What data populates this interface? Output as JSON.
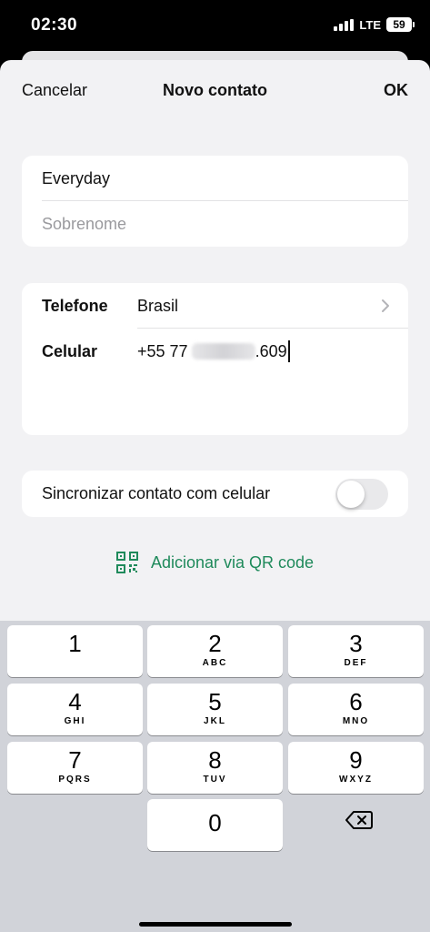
{
  "status_bar": {
    "time": "02:30",
    "network": "LTE",
    "battery": "59"
  },
  "nav": {
    "cancel": "Cancelar",
    "title": "Novo contato",
    "ok": "OK"
  },
  "name_card": {
    "first_name_value": "Everyday",
    "last_name_placeholder": "Sobrenome"
  },
  "phone_card": {
    "phone_label": "Telefone",
    "country": "Brasil",
    "mobile_label": "Celular",
    "mobile_prefix": "+55  77",
    "mobile_suffix": ".609"
  },
  "sync": {
    "label": "Sincronizar contato com celular",
    "enabled": false
  },
  "qr": {
    "label": "Adicionar via QR code",
    "color": "#1f8a5b"
  },
  "keypad": {
    "keys": [
      {
        "num": "1",
        "letters": ""
      },
      {
        "num": "2",
        "letters": "ABC"
      },
      {
        "num": "3",
        "letters": "DEF"
      },
      {
        "num": "4",
        "letters": "GHI"
      },
      {
        "num": "5",
        "letters": "JKL"
      },
      {
        "num": "6",
        "letters": "MNO"
      },
      {
        "num": "7",
        "letters": "PQRS"
      },
      {
        "num": "8",
        "letters": "TUV"
      },
      {
        "num": "9",
        "letters": "WXYZ"
      },
      {
        "num": "0",
        "letters": ""
      }
    ],
    "backspace_icon": "backspace-icon"
  }
}
